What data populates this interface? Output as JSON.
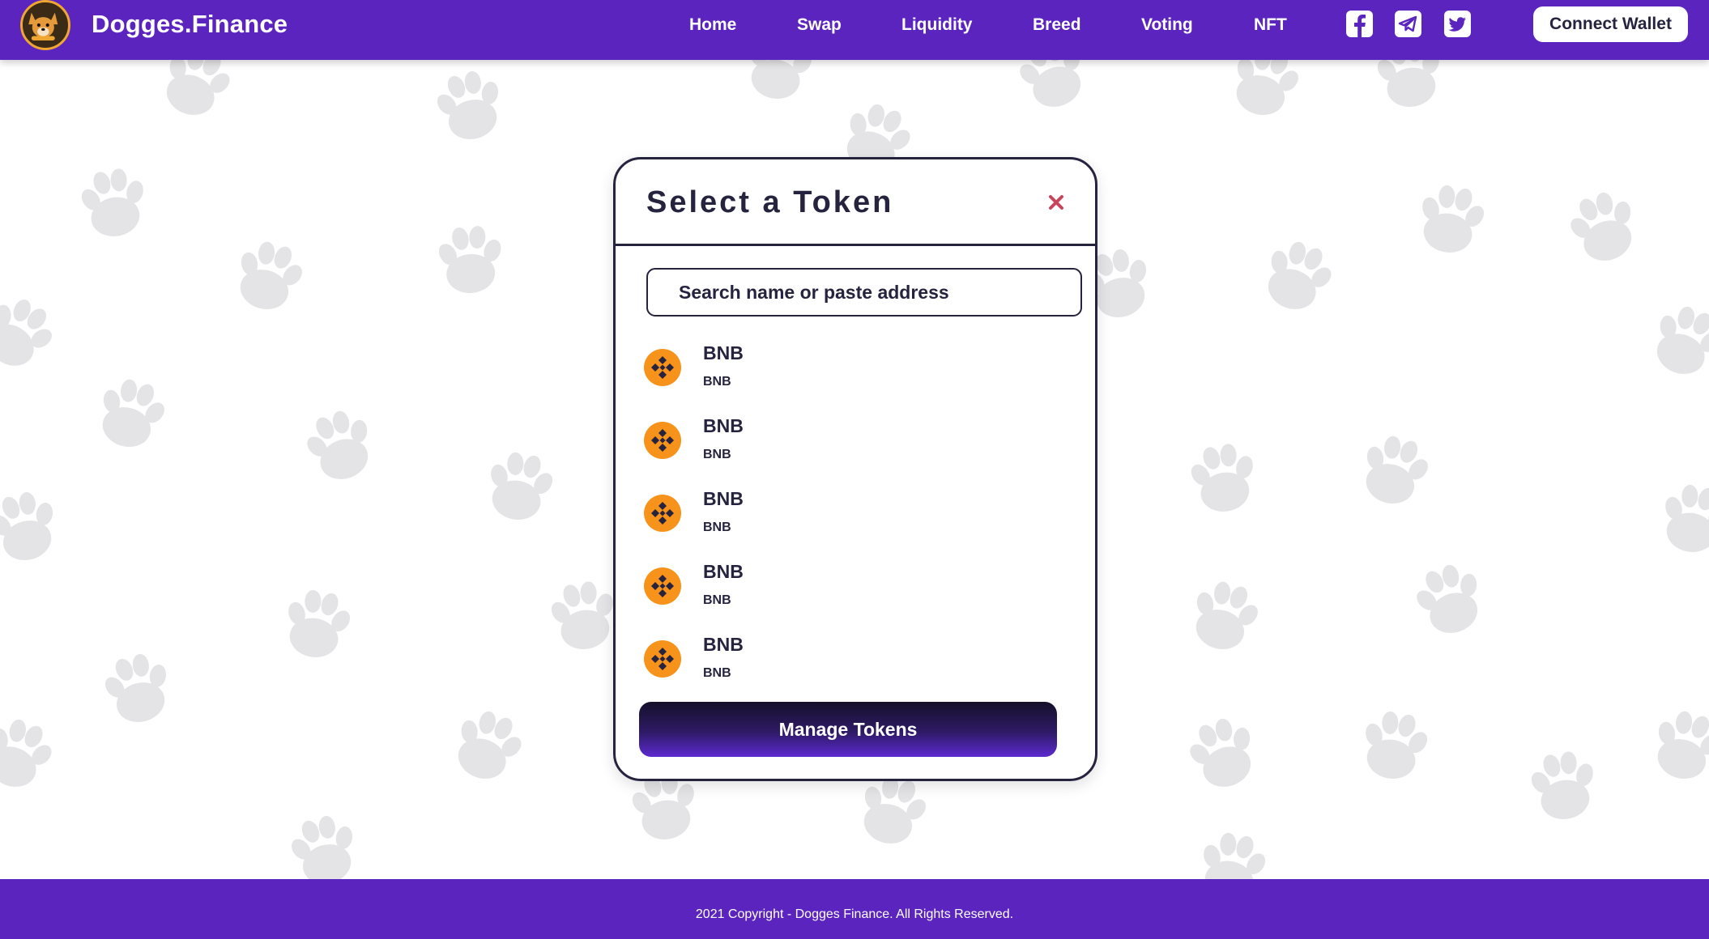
{
  "header": {
    "brand": "Dogges.Finance",
    "logo_icon": "dog-logo-icon",
    "nav": [
      {
        "label": "Home"
      },
      {
        "label": "Swap"
      },
      {
        "label": "Liquidity"
      },
      {
        "label": "Breed"
      },
      {
        "label": "Voting"
      },
      {
        "label": "NFT"
      }
    ],
    "social_icons": [
      "facebook-icon",
      "telegram-icon",
      "twitter-icon"
    ],
    "connect_wallet": "Connect Wallet"
  },
  "modal": {
    "title": "Select a Token",
    "close_icon": "close-icon",
    "search": {
      "placeholder": "Search name or paste address",
      "value": ""
    },
    "tokens": [
      {
        "name": "BNB",
        "symbol": "BNB",
        "icon": "bnb-icon"
      },
      {
        "name": "BNB",
        "symbol": "BNB",
        "icon": "bnb-icon"
      },
      {
        "name": "BNB",
        "symbol": "BNB",
        "icon": "bnb-icon"
      },
      {
        "name": "BNB",
        "symbol": "BNB",
        "icon": "bnb-icon"
      },
      {
        "name": "BNB",
        "symbol": "BNB",
        "icon": "bnb-icon"
      }
    ],
    "manage_button": "Manage Tokens"
  },
  "footer": {
    "copyright": "2021 Copyright - Dogges Finance. All Rights Reserved."
  },
  "colors": {
    "brand_purple": "#5b24bf",
    "text_dark": "#26233f",
    "close_red": "#c7465c",
    "bnb_orange": "#f7931a",
    "paw_gray": "#e4e4e6"
  }
}
